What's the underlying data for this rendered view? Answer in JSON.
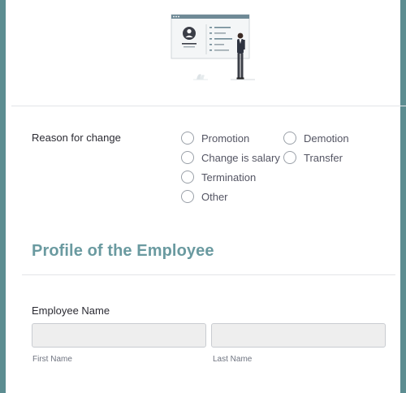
{
  "reason": {
    "label": "Reason for change",
    "options": [
      "Promotion",
      "Demotion",
      "Change is salary",
      "Transfer",
      "Termination",
      "Other"
    ]
  },
  "profile": {
    "title": "Profile of the Employee",
    "employee_name": {
      "label": "Employee Name",
      "first_value": "",
      "last_value": "",
      "first_sublabel": "First Name",
      "last_sublabel": "Last Name"
    }
  },
  "colors": {
    "frame": "#5c8d91",
    "section_title": "#6a9aa0",
    "input_bg": "#eeeeee"
  },
  "icons": [
    "presentation-illustration",
    "radio-unchecked"
  ]
}
